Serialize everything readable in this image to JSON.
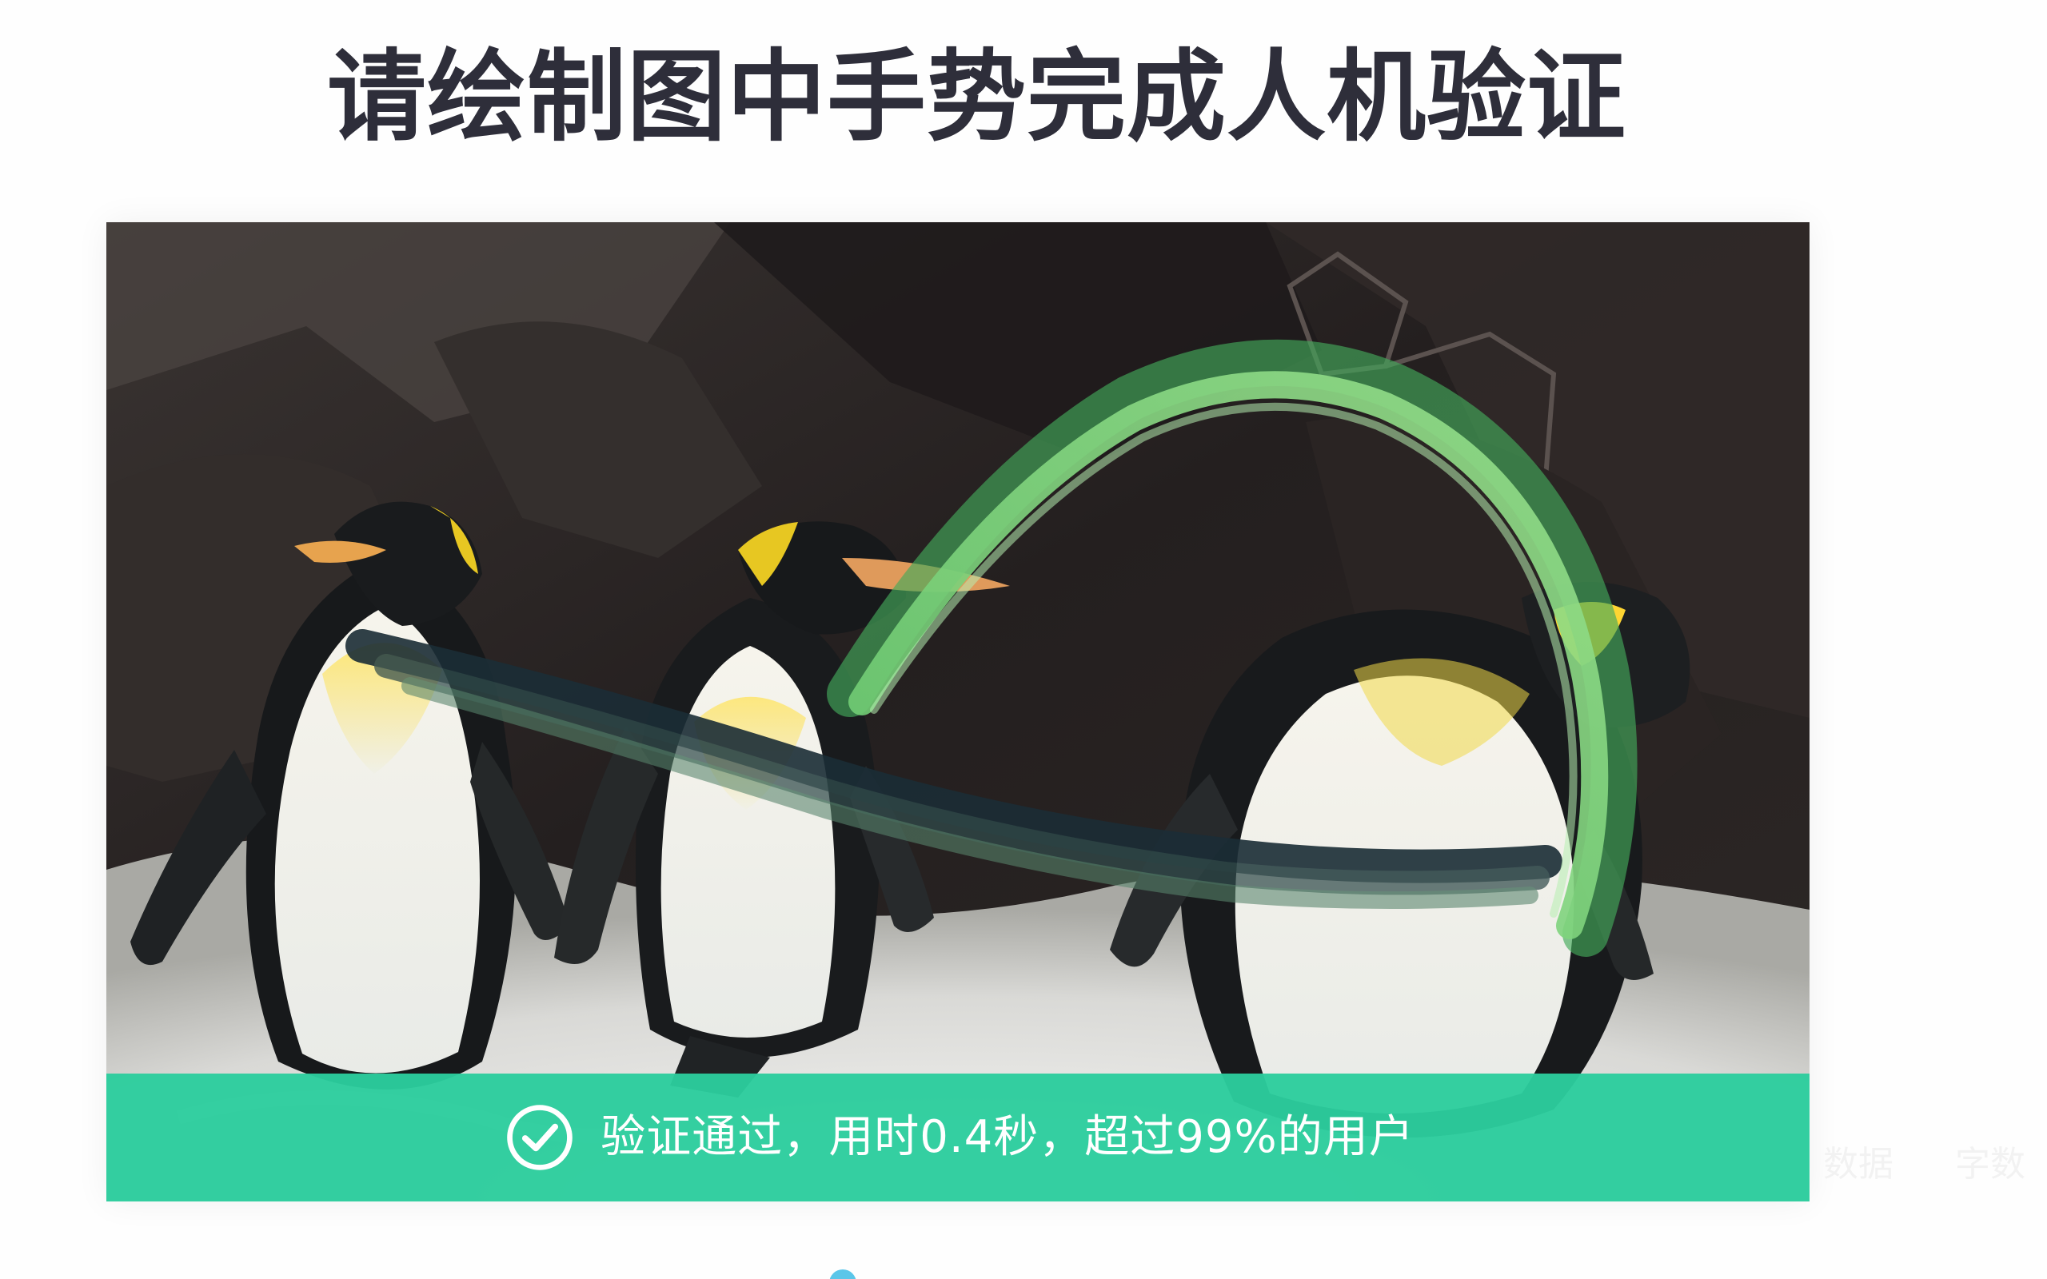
{
  "title": "请绘制图中手势完成人机验证",
  "captcha": {
    "image_subject": "king penguins",
    "success_icon": "check-circle-icon",
    "success_message": "验证通过，用时0.4秒，超过99%的用户",
    "colors": {
      "success_bar": "#2ccd9d",
      "gesture_stroke": "#6fd67b",
      "dark_stroke": "#233a3c",
      "title_text": "#2e2e3a"
    }
  },
  "background_hints": {
    "left": "数据",
    "right": "字数"
  }
}
